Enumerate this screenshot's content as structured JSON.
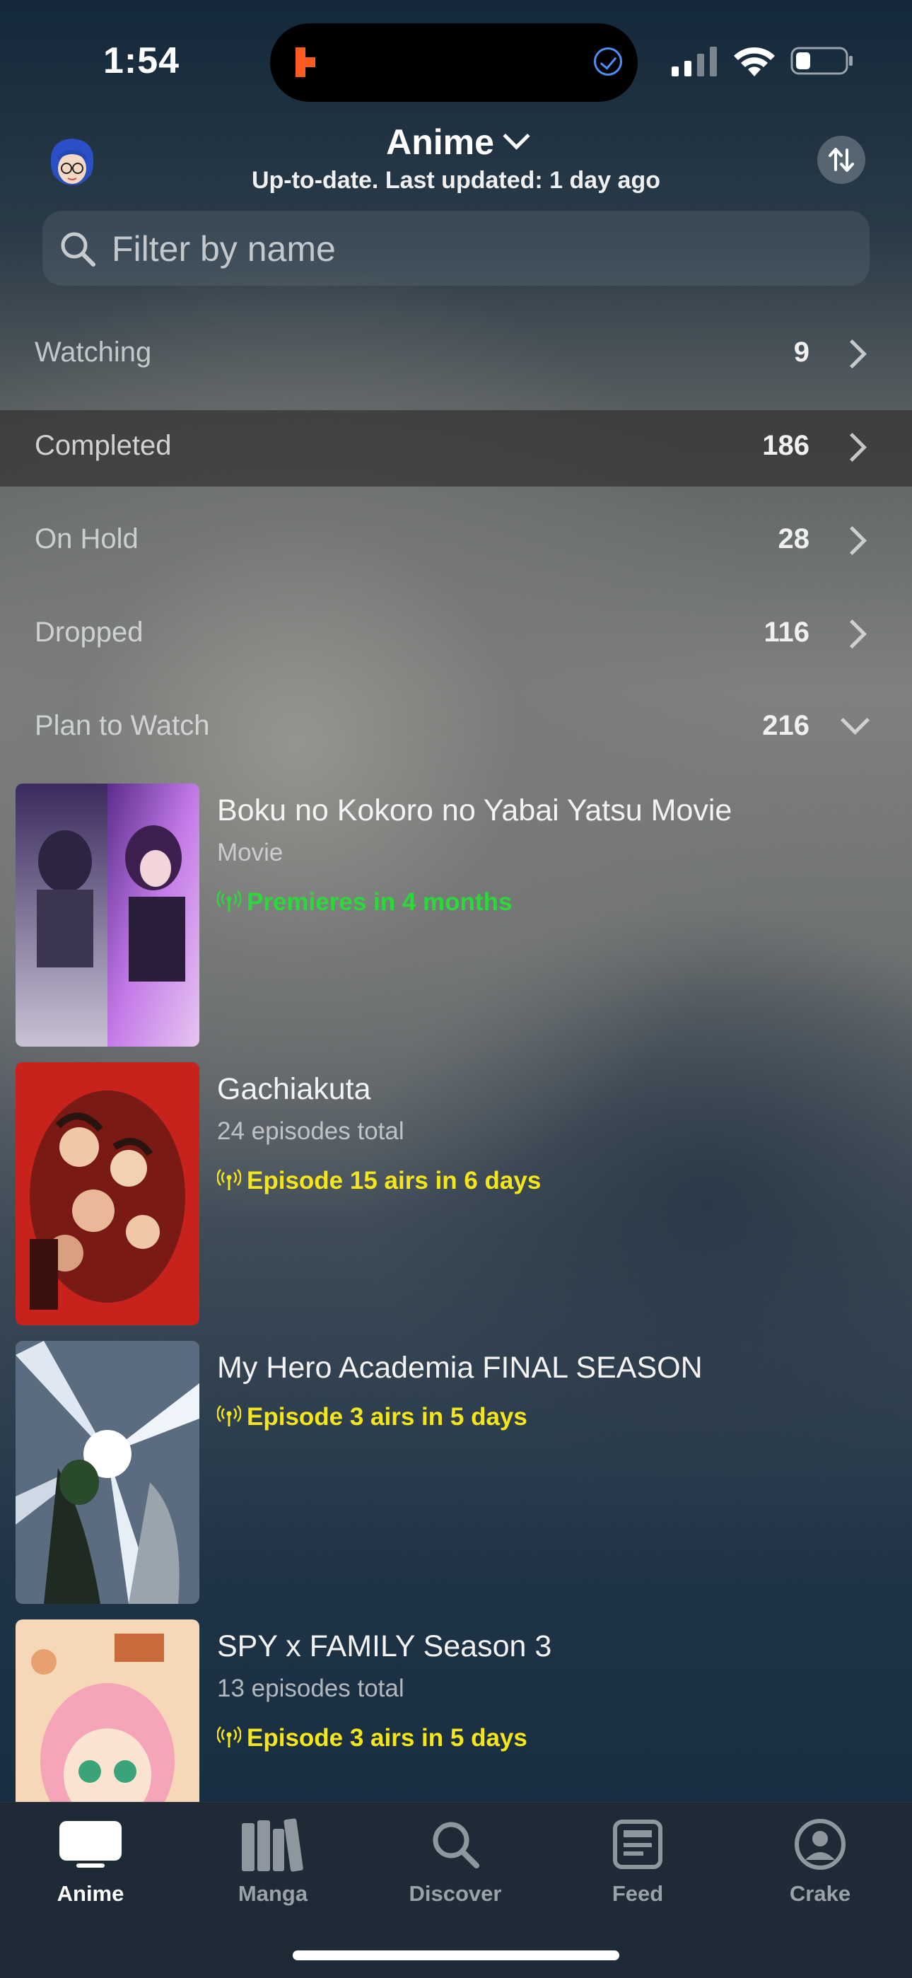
{
  "status_bar": {
    "time": "1:54"
  },
  "header": {
    "title": "Anime",
    "subtitle": "Up-to-date. Last updated: 1 day ago"
  },
  "search": {
    "placeholder": "Filter by name"
  },
  "categories": [
    {
      "label": "Watching",
      "count": "9"
    },
    {
      "label": "Completed",
      "count": "186"
    },
    {
      "label": "On Hold",
      "count": "28"
    },
    {
      "label": "Dropped",
      "count": "116"
    },
    {
      "label": "Plan to Watch",
      "count": "216"
    }
  ],
  "items": [
    {
      "title": "Boku no Kokoro no Yabai Yatsu Movie",
      "subtitle": "Movie",
      "airing": "Premieres in 4 months",
      "airing_color": "#2bd93a"
    },
    {
      "title": "Gachiakuta",
      "subtitle": "24 episodes total",
      "airing": "Episode 15 airs in 6 days",
      "airing_color": "#f5e61b"
    },
    {
      "title": "My Hero Academia FINAL SEASON",
      "subtitle": "",
      "airing": "Episode 3 airs in 5 days",
      "airing_color": "#f5e61b"
    },
    {
      "title": "SPY x FAMILY Season 3",
      "subtitle": "13 episodes total",
      "airing": "Episode 3 airs in 5 days",
      "airing_color": "#f5e61b"
    }
  ],
  "tabs": [
    {
      "label": "Anime",
      "icon": "tv-icon",
      "active": true
    },
    {
      "label": "Manga",
      "icon": "books-icon",
      "active": false
    },
    {
      "label": "Discover",
      "icon": "search-icon",
      "active": false
    },
    {
      "label": "Feed",
      "icon": "feed-icon",
      "active": false
    },
    {
      "label": "Crake",
      "icon": "profile-icon",
      "active": false
    }
  ]
}
